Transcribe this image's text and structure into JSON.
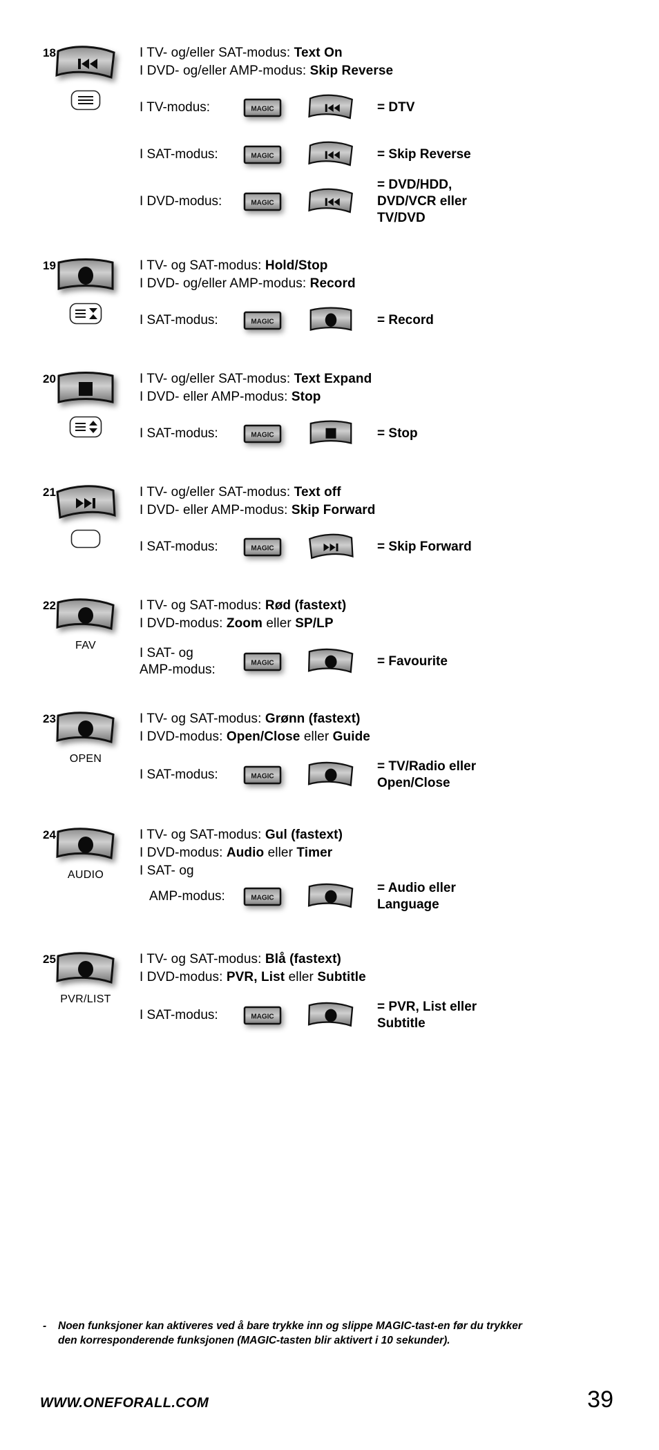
{
  "page": {
    "number": "39",
    "brand": "WWW.ONEFORALL.COM",
    "footnote_dash": "-",
    "footnote_text": "Noen funksjoner kan aktiveres ved å bare trykke inn og slippe MAGIC-tast-en før du trykker den korresponderende funksjonen (MAGIC-tasten blir aktivert i 10 sekunder)."
  },
  "labels": {
    "magic": "MAGIC",
    "equals": "="
  },
  "entries": [
    {
      "number": "18",
      "key_icon": "skip-reverse-key",
      "key_label": "",
      "pictogram": "text-lines-icon",
      "lines": [
        {
          "prefix": "I TV- og/eller SAT-modus: ",
          "bold": "Text On"
        },
        {
          "prefix": "I DVD- og/eller AMP-modus: ",
          "bold": "Skip Reverse"
        }
      ],
      "combos": [
        {
          "mode": "I TV-modus:",
          "key_icon": "skip-reverse-key",
          "result": "DTV"
        },
        {
          "mode": "I SAT-modus:",
          "key_icon": "skip-reverse-key",
          "result": "Skip Reverse"
        },
        {
          "mode": "I DVD-modus:",
          "key_icon": "skip-reverse-key",
          "result": "DVD/HDD,\nDVD/VCR eller\nTV/DVD",
          "result_plain_words": [
            "eller"
          ]
        }
      ]
    },
    {
      "number": "19",
      "key_icon": "record-dot-key",
      "key_label": "",
      "pictogram": "text-hold-icon",
      "lines": [
        {
          "prefix": "I TV- og SAT-modus: ",
          "bold": "Hold/Stop"
        },
        {
          "prefix": "I DVD- og/eller AMP-modus: ",
          "bold": "Record"
        }
      ],
      "combos": [
        {
          "mode": "I SAT-modus:",
          "key_icon": "record-dot-key",
          "result": "Record"
        }
      ]
    },
    {
      "number": "20",
      "key_icon": "stop-square-key",
      "key_label": "",
      "pictogram": "text-expand-icon",
      "lines": [
        {
          "prefix": "I TV- og/eller SAT-modus: ",
          "bold": "Text Expand"
        },
        {
          "prefix": "I DVD- eller AMP-modus: ",
          "bold": "Stop"
        }
      ],
      "combos": [
        {
          "mode": "I SAT-modus:",
          "key_icon": "stop-square-key",
          "result": "Stop"
        }
      ]
    },
    {
      "number": "21",
      "key_icon": "skip-forward-key",
      "key_label": "",
      "pictogram": "text-off-icon",
      "lines": [
        {
          "prefix": "I TV- og/eller SAT-modus: ",
          "bold": "Text off"
        },
        {
          "prefix": "I DVD- eller AMP-modus: ",
          "bold": "Skip Forward"
        }
      ],
      "combos": [
        {
          "mode": "I SAT-modus:",
          "key_icon": "skip-forward-key",
          "result": "Skip Forward"
        }
      ]
    },
    {
      "number": "22",
      "key_icon": "round-dot-key",
      "key_label": "FAV",
      "pictogram": "",
      "lines": [
        {
          "prefix": "I TV- og SAT-modus: ",
          "bold": "Rød (fastext)"
        },
        {
          "prefix": "I DVD-modus: ",
          "bold": "Zoom",
          "mid": " eller ",
          "bold2": "SP/LP"
        }
      ],
      "combos": [
        {
          "mode": "I SAT- og\nAMP-modus:",
          "key_icon": "round-dot-key",
          "result": "Favourite"
        }
      ]
    },
    {
      "number": "23",
      "key_icon": "round-dot-key",
      "key_label": "OPEN",
      "pictogram": "",
      "lines": [
        {
          "prefix": "I TV- og SAT-modus: ",
          "bold": "Grønn (fastext)"
        },
        {
          "prefix": "I DVD-modus: ",
          "bold": "Open/Close",
          "mid": " eller ",
          "bold2": "Guide"
        }
      ],
      "combos": [
        {
          "mode": "I SAT-modus:",
          "key_icon": "round-dot-key",
          "result": "TV/Radio eller\nOpen/Close"
        }
      ]
    },
    {
      "number": "24",
      "key_icon": "round-dot-key",
      "key_label": "AUDIO",
      "pictogram": "",
      "lines": [
        {
          "prefix": "I TV- og SAT-modus: ",
          "bold": "Gul (fastext)"
        },
        {
          "prefix": "I DVD-modus: ",
          "bold": "Audio",
          "mid": " eller ",
          "bold2": "Timer"
        },
        {
          "prefix": "I SAT- og",
          "bold": ""
        }
      ],
      "combos": [
        {
          "mode": "AMP-modus:",
          "key_icon": "round-dot-key",
          "result": "Audio eller\nLanguage",
          "indent": true
        }
      ]
    },
    {
      "number": "25",
      "key_icon": "round-dot-key",
      "key_label": "PVR/LIST",
      "pictogram": "",
      "lines": [
        {
          "prefix": "I TV- og SAT-modus: ",
          "bold": "Blå (fastext)"
        },
        {
          "prefix": "I DVD-modus: ",
          "bold": "PVR, List",
          "mid": " eller ",
          "bold2": "Subtitle"
        }
      ],
      "combos": [
        {
          "mode": "I SAT-modus:",
          "key_icon": "round-dot-key",
          "result": "PVR, List eller\nSubtitle"
        }
      ]
    }
  ]
}
